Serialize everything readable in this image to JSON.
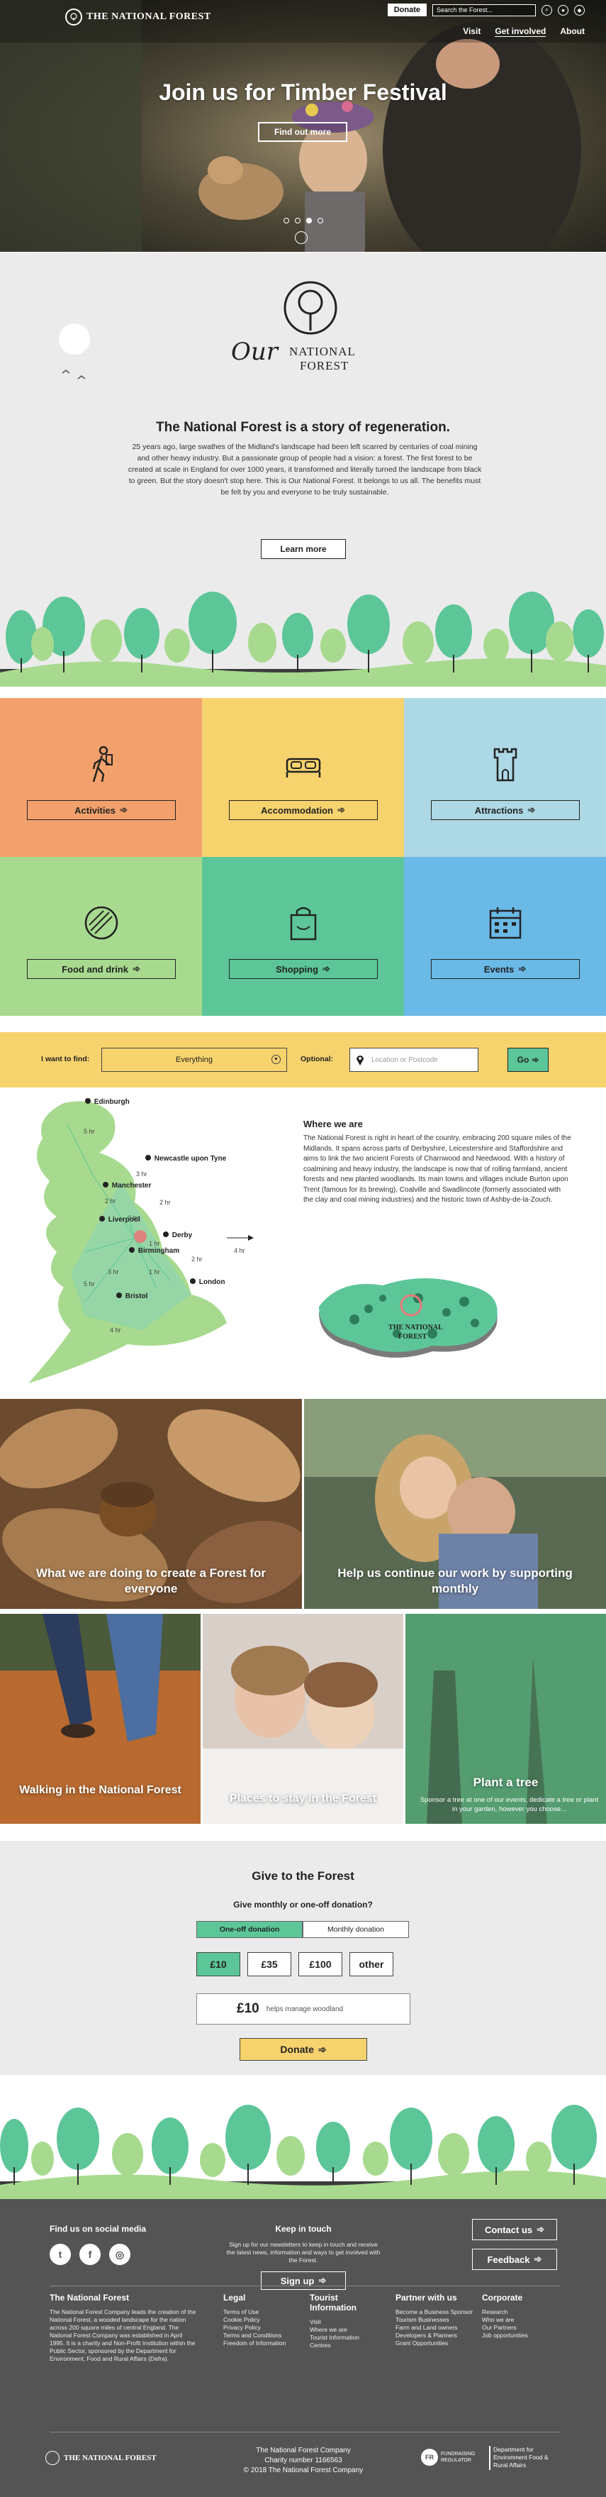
{
  "header": {
    "logo": "THE NATIONAL FOREST",
    "donate": "Donate",
    "search_placeholder": "Search the Forest...",
    "nav": [
      "Visit",
      "Get involved",
      "About"
    ]
  },
  "hero": {
    "title": "Join us for Timber Festival",
    "cta": "Find out more",
    "slides": 4,
    "active_slide": 3
  },
  "story": {
    "logo_script": "Our",
    "logo_line1": "NATIONAL",
    "logo_line2": "FOREST",
    "heading": "The National Forest is a story of regeneration.",
    "body": "25 years ago, large swathes of the Midland's landscape had been left scarred by centuries of coal mining and other heavy industry. But a passionate group of people had a vision: a forest. The first forest to be created at scale in England for over 1000 years, it transformed and literally turned the landscape from black to green. But the story doesn't stop here. This is Our National Forest. It belongs to us all. The benefits must be felt by you and everyone to be truly sustainable.",
    "cta": "Learn more"
  },
  "categories": [
    {
      "label": "Activities",
      "icon": "hiker-icon",
      "color": "#f3a16c"
    },
    {
      "label": "Accommodation",
      "icon": "bed-icon",
      "color": "#f7d36e"
    },
    {
      "label": "Attractions",
      "icon": "tower-icon",
      "color": "#add8e6"
    },
    {
      "label": "Food and drink",
      "icon": "food-icon",
      "color": "#a7da8e"
    },
    {
      "label": "Shopping",
      "icon": "shopping-bag-icon",
      "color": "#5cc698"
    },
    {
      "label": "Events",
      "icon": "calendar-icon",
      "color": "#6ab9e6"
    }
  ],
  "finder": {
    "label": "I want to find:",
    "selected": "Everything",
    "optional_label": "Optional:",
    "location_placeholder": "Location or Postcode",
    "go": "Go"
  },
  "map": {
    "heading": "Where we are",
    "body": "The National Forest is right in heart of the country, embracing 200 square miles of the Midlands. It spans across parts of Derbyshire, Leicestershire and Staffordshire and aims to link the two ancient Forests of Charnwood and Needwood. With a history of coalmining and heavy industry, the landscape is now that of rolling farmland, ancient forests and new planted woodlands. Its main towns and villages include Burton upon Trent (famous for its brewing), Coalville and Swadlincote (formerly associated with the clay and coal mining industries) and the historic town of Ashby-de-la-Zouch.",
    "cities": [
      "Edinburgh",
      "Newcastle upon Tyne",
      "Manchester",
      "Liverpool",
      "Derby",
      "Birmingham",
      "Bristol",
      "London"
    ],
    "times": [
      "5 hr",
      "3 hr",
      "2 hr",
      "2 hr",
      "2 hr",
      "1 hr",
      "4 hr",
      "1 hr",
      "2 hr",
      "3 hr",
      "5 hr",
      "4 hr"
    ],
    "inset_label_1": "THE NATIONAL",
    "inset_label_2": "FOREST"
  },
  "features": [
    "What we are doing to create a Forest for everyone",
    "Help us continue our work by supporting monthly",
    "Walking in the National Forest",
    "Places to stay in the Forest",
    "Plant a tree"
  ],
  "plant_tree_desc": "Sponsor a tree at one of our events, dedicate a tree or plant in your garden, however you choose...",
  "give": {
    "heading": "Give to the Forest",
    "question": "Give monthly or one-off donation?",
    "tabs": [
      "One-off donation",
      "Monthly donation"
    ],
    "amounts": [
      "£10",
      "£35",
      "£100",
      "other"
    ],
    "selected_amount": "£10",
    "note": "helps manage woodland",
    "cta": "Donate"
  },
  "footer": {
    "social_heading": "Find us on social media",
    "social": [
      "twitter-icon",
      "facebook-icon",
      "instagram-icon"
    ],
    "keep_heading": "Keep in touch",
    "keep_body": "Sign up for our newsletters to keep in touch and receive the latest news, information and ways to get involved with the Forest.",
    "signup": "Sign up",
    "contact": "Contact us",
    "feedback": "Feedback",
    "about_heading": "The National Forest",
    "about_body": "The National Forest Company leads the creation of the National Forest, a wooded landscape for the nation across 200 square miles of central England. The National Forest Company was established in April 1995. It is a charity and Non-Profit Institution within the Public Sector, sponsored by the Department for Environment, Food and Rural Affairs (Defra).",
    "legal_heading": "Legal",
    "legal": [
      "Terms of Use",
      "Cookie Policy",
      "Privacy Policy",
      "Terms and Conditions",
      "Freedom of Information"
    ],
    "tourist_heading": "Tourist Information",
    "tourist": [
      "Visit",
      "Where we are",
      "Tourist Information Centres"
    ],
    "partner_heading": "Partner with us",
    "partner": [
      "Become a Business Sponsor",
      "Tourism Businesses",
      "Farm and Land owners",
      "Developers & Planners",
      "Grant Opportunities"
    ],
    "corporate_heading": "Corporate",
    "corporate": [
      "Research",
      "Who we are",
      "Our Partners",
      "Job opportunities"
    ],
    "company": "The National Forest Company",
    "charity": "Charity number 1166563",
    "copyright": "© 2018 The National Forest Company",
    "logo": "THE NATIONAL FOREST",
    "regulator": "FUNDRAISING REGULATOR",
    "defra": "Department for Environment Food & Rural Affairs"
  }
}
